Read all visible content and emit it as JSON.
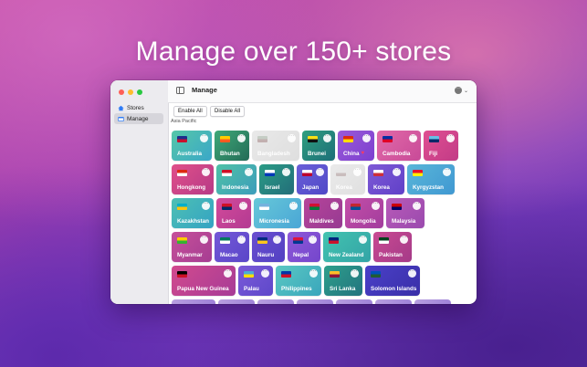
{
  "hero": {
    "title": "Manage over 150+ stores"
  },
  "sidebar": {
    "items": [
      {
        "label": "Stores",
        "icon": "house-icon",
        "active": false
      },
      {
        "label": "Manage",
        "icon": "window-icon",
        "active": true
      }
    ]
  },
  "titlebar": {
    "title": "Manage",
    "more_icon": "ellipsis-circle-icon"
  },
  "toolbar": {
    "enable_all": "Enable All",
    "disable_all": "Disable All"
  },
  "section": {
    "label": "Asia Pacific"
  },
  "stores": [
    {
      "name": "Australia",
      "colors": [
        "#56c7a8",
        "#3aa7c8"
      ],
      "flag": [
        "#1b2e8c",
        "#c8102e"
      ],
      "enabled": true
    },
    {
      "name": "Bhutan",
      "colors": [
        "#3ea978",
        "#246b57"
      ],
      "flag": [
        "#ffcc00",
        "#ff5a1f"
      ],
      "enabled": true
    },
    {
      "name": "Bangladesh",
      "colors": [
        "#cfcfcf",
        "#b8b8b8"
      ],
      "flag": [
        "#6a9a6a",
        "#aa4444"
      ],
      "enabled": false
    },
    {
      "name": "Brunei",
      "colors": [
        "#2f9f7f",
        "#1d6e78"
      ],
      "flag": [
        "#f7e017",
        "#111111"
      ],
      "enabled": true
    },
    {
      "name": "China",
      "colors": [
        "#9a5ad8",
        "#7c3fd0"
      ],
      "flag": [
        "#de2910",
        "#ffde00"
      ],
      "enabled": true,
      "favorite": true
    },
    {
      "name": "Cambodia",
      "colors": [
        "#e26aa8",
        "#c84a98"
      ],
      "flag": [
        "#032ea1",
        "#e00025"
      ],
      "enabled": true
    },
    {
      "name": "Fiji",
      "colors": [
        "#e04f92",
        "#c23b86"
      ],
      "flag": [
        "#68bfe5",
        "#002868"
      ],
      "enabled": true
    },
    {
      "name": "Hongkong",
      "colors": [
        "#e0508a",
        "#b73a86"
      ],
      "flag": [
        "#de2910",
        "#ffffff"
      ],
      "enabled": true
    },
    {
      "name": "Indonesia",
      "colors": [
        "#4fc1a6",
        "#3c9dbb"
      ],
      "flag": [
        "#ce1126",
        "#ffffff"
      ],
      "enabled": true
    },
    {
      "name": "Israel",
      "colors": [
        "#2a9c86",
        "#236d79"
      ],
      "flag": [
        "#ffffff",
        "#0038b8"
      ],
      "enabled": true
    },
    {
      "name": "Japan",
      "colors": [
        "#6b5fd8",
        "#4f49c7"
      ],
      "flag": [
        "#ffffff",
        "#bc002d"
      ],
      "enabled": true
    },
    {
      "name": "Korea",
      "colors": [
        "#d2d2d2",
        "#bcbcbc"
      ],
      "flag": [
        "#cccccc",
        "#aa6666"
      ],
      "enabled": false
    },
    {
      "name": "Korea",
      "colors": [
        "#7e5ad6",
        "#6040c8"
      ],
      "flag": [
        "#ffffff",
        "#cd2e3a"
      ],
      "enabled": true
    },
    {
      "name": "Kyrgyzstan",
      "colors": [
        "#59b6d8",
        "#4098d2"
      ],
      "flag": [
        "#e8112d",
        "#ffef00"
      ],
      "enabled": true
    },
    {
      "name": "Kazakhstan",
      "colors": [
        "#4dc0b4",
        "#34a3c3"
      ],
      "flag": [
        "#00afca",
        "#fec50c"
      ],
      "enabled": true
    },
    {
      "name": "Laos",
      "colors": [
        "#d24a9a",
        "#b33a92"
      ],
      "flag": [
        "#ce1126",
        "#002868"
      ],
      "enabled": true
    },
    {
      "name": "Micronesia",
      "colors": [
        "#66c8d8",
        "#4aa6d6"
      ],
      "flag": [
        "#75b2dd",
        "#ffffff"
      ],
      "enabled": true
    },
    {
      "name": "Maldives",
      "colors": [
        "#b7449a",
        "#963a92"
      ],
      "flag": [
        "#d21034",
        "#007e3a"
      ],
      "enabled": true
    },
    {
      "name": "Mongolia",
      "colors": [
        "#c44ea8",
        "#a23d9d"
      ],
      "flag": [
        "#c4272f",
        "#015197"
      ],
      "enabled": true
    },
    {
      "name": "Malaysia",
      "colors": [
        "#b85ab8",
        "#9a4aae"
      ],
      "flag": [
        "#cc0001",
        "#010066"
      ],
      "enabled": true
    },
    {
      "name": "Myanmar",
      "colors": [
        "#c6509a",
        "#a63d92"
      ],
      "flag": [
        "#fecb00",
        "#34b233"
      ],
      "enabled": true
    },
    {
      "name": "Macao",
      "colors": [
        "#7458d8",
        "#5a46c8"
      ],
      "flag": [
        "#00785e",
        "#ffffff"
      ],
      "enabled": true
    },
    {
      "name": "Nauru",
      "colors": [
        "#6a4fd0",
        "#5240c2"
      ],
      "flag": [
        "#002b7f",
        "#ffc61e"
      ],
      "enabled": true
    },
    {
      "name": "Nepal",
      "colors": [
        "#8e58d8",
        "#7446cc"
      ],
      "flag": [
        "#dc143c",
        "#003893"
      ],
      "enabled": true
    },
    {
      "name": "New Zealand",
      "colors": [
        "#43c3b0",
        "#33a4a6"
      ],
      "flag": [
        "#00247d",
        "#cc142b"
      ],
      "enabled": true
    },
    {
      "name": "Pakistan",
      "colors": [
        "#c94a92",
        "#a53a88"
      ],
      "flag": [
        "#01411c",
        "#ffffff"
      ],
      "enabled": true
    },
    {
      "name": "Papua New Guinea",
      "colors": [
        "#d24a8e",
        "#a73c96"
      ],
      "flag": [
        "#000000",
        "#ce1126"
      ],
      "enabled": true
    },
    {
      "name": "Palau",
      "colors": [
        "#7a5ad8",
        "#5e48ca"
      ],
      "flag": [
        "#4aadd6",
        "#ffde00"
      ],
      "enabled": true
    },
    {
      "name": "Philippines",
      "colors": [
        "#5ac8c2",
        "#3aa6bc"
      ],
      "flag": [
        "#0038a8",
        "#ce1126"
      ],
      "enabled": true
    },
    {
      "name": "Sri Lanka",
      "colors": [
        "#2e9f8c",
        "#22747e"
      ],
      "flag": [
        "#ffbe29",
        "#8d153a"
      ],
      "enabled": true
    },
    {
      "name": "Solomon Islands",
      "colors": [
        "#4a40c8",
        "#3a2fa8"
      ],
      "flag": [
        "#0051ba",
        "#215b33"
      ],
      "enabled": true
    }
  ]
}
